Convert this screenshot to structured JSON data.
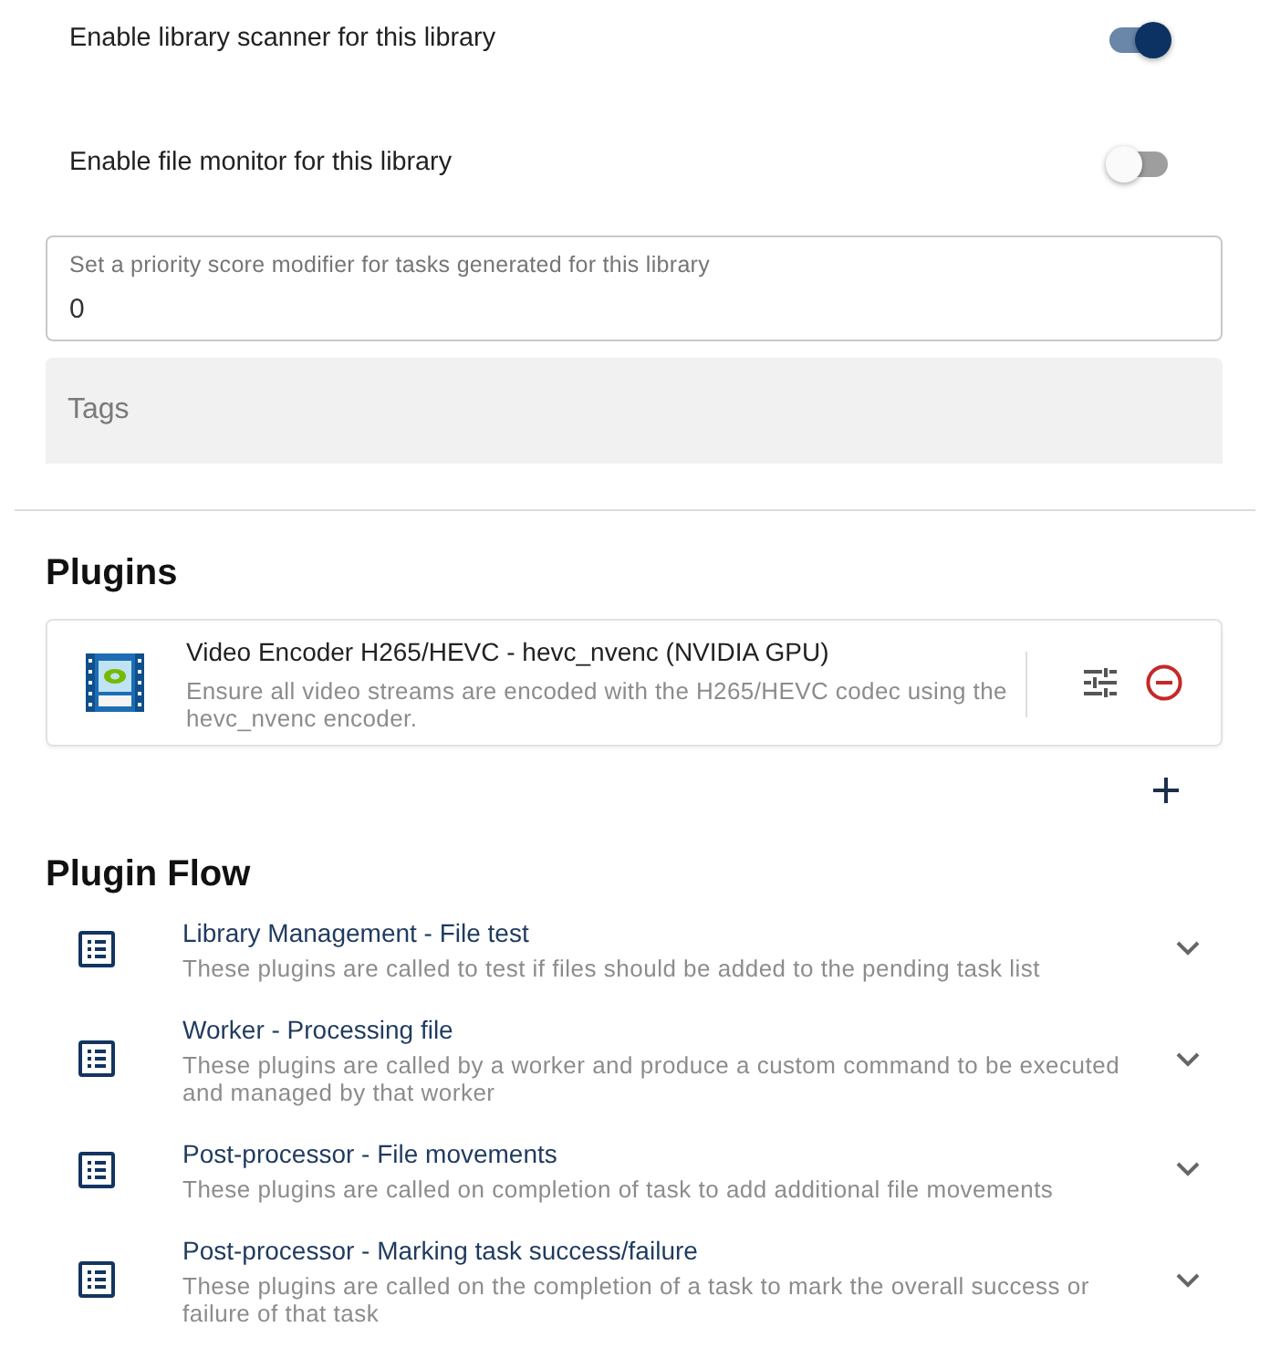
{
  "settings": {
    "toggles": [
      {
        "label": "Enable library scanner for this library",
        "on": true
      },
      {
        "label": "Enable file monitor for this library",
        "on": false
      }
    ],
    "priority_field": {
      "label": "Set a priority score modifier for tasks generated for this library",
      "value": "0"
    },
    "tags_field": {
      "placeholder": "Tags"
    }
  },
  "plugins": {
    "title": "Plugins",
    "items": [
      {
        "name": "Video Encoder H265/HEVC - hevc_nvenc (NVIDIA GPU)",
        "description": "Ensure all video streams are encoded with the H265/HEVC codec using the hevc_nvenc encoder."
      }
    ]
  },
  "plugin_flow": {
    "title": "Plugin Flow",
    "items": [
      {
        "title": "Library Management - File test",
        "description": "These plugins are called to test if files should be added to the pending task list",
        "expanded": false
      },
      {
        "title": "Worker - Processing file",
        "description": "These plugins are called by a worker and produce a custom command to be executed and managed by that worker",
        "expanded": false
      },
      {
        "title": "Post-processor - File movements",
        "description": "These plugins are called on completion of task to add additional file movements",
        "expanded": false
      },
      {
        "title": "Post-processor - Marking task success/failure",
        "description": "These plugins are called on the completion of a task to mark the overall success or failure of that task",
        "expanded": false
      }
    ]
  }
}
